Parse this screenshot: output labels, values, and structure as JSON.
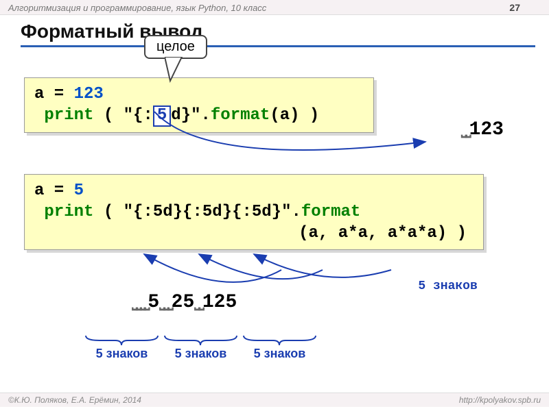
{
  "header": {
    "course": "Алгоритмизация и программирование, язык Python, 10 класс",
    "page": "27"
  },
  "title": "Форматный вывод",
  "callout": {
    "label": "целое"
  },
  "code1": {
    "line1a": "a = ",
    "line1b": "123",
    "print": "print",
    "open": " ( ",
    "str1": "\"{:",
    "mark": "5",
    "str2": "d}\"",
    "dot": ".",
    "format": "format",
    "args": "(a) )"
  },
  "output1": {
    "value": "123",
    "label": "5 знаков"
  },
  "code2": {
    "line1a": "a = ",
    "line1b": "5",
    "print": "print",
    "open": " ( ",
    "str": "\"{:5d}{:5d}{:5d}\"",
    "dot": ".",
    "format": "format",
    "args_line2": "(a, a*a, a*a*a) )"
  },
  "output2": {
    "v1": "5",
    "v2": "25",
    "v3": "125",
    "label1": "5 знаков",
    "label2": "5 знаков",
    "label3": "5 знаков"
  },
  "footer": {
    "left": "К.Ю. Поляков, Е.А. Ерёмин, 2014",
    "right": "http://kpolyakov.spb.ru"
  }
}
